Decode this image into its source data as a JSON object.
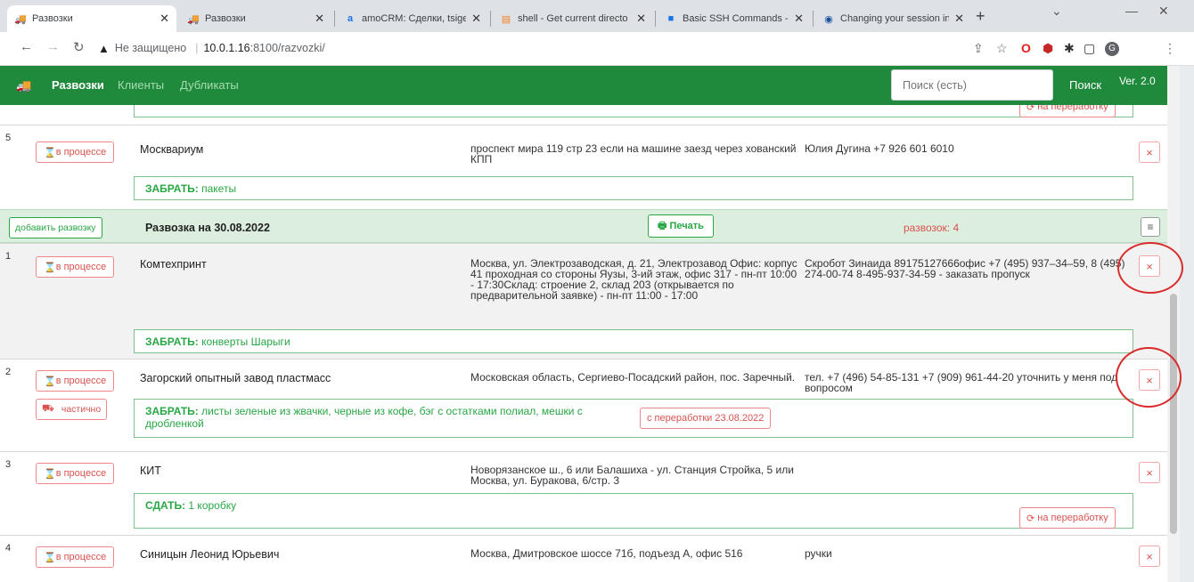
{
  "browser": {
    "tabs": [
      {
        "title": "Развозки",
        "active": true
      },
      {
        "title": "Развозки",
        "active": false
      },
      {
        "title": "amoCRM: Сделки, tsigel",
        "active": false
      },
      {
        "title": "shell - Get current directo",
        "active": false
      },
      {
        "title": "Basic SSH Commands - ",
        "active": false
      },
      {
        "title": "Changing your session in",
        "active": false
      }
    ],
    "address": {
      "insecure_label": "Не защищено",
      "host": "10.0.1.16",
      "port_path": ":8100/razvozki/"
    }
  },
  "navbar": {
    "brand": "Развозки",
    "links": [
      "Клиенты",
      "Дубликаты"
    ],
    "search_placeholder": "Поиск (есть)",
    "search_button": "Поиск",
    "version": "Ver. 2.0"
  },
  "top_partial": {
    "rework_label": "на переработку"
  },
  "row5": {
    "index": "5",
    "status": "в процессе",
    "name": "Москвариум",
    "address": "проспект мира 119 стр 23 если на машине заезд через хованский КПП",
    "contact": "Юлия Дугина +7 926 601 6010",
    "pick_label": "ЗАБРАТЬ:",
    "pick_text": "пакеты"
  },
  "group": {
    "add_button": "добавить развозку",
    "title": "Развозка на 30.08.2022",
    "print_button": "Печать",
    "count": "развозок: 4"
  },
  "rows": [
    {
      "index": "1",
      "status": "в процессе",
      "name": "Комтехпринт",
      "address": "Москва, ул. Электрозаводская, д. 21, Электрозавод Офис: корпус 41 проходная со стороны Яузы, 3-ий этаж, офис 317 - пн-пт 10:00 - 17:30Склад: строение 2, склад 203 (открывается по предварительной заявке) - пн-пт 11:00 - 17:00",
      "contact": "Скробот Зинаида 89175127666офис +7 (495) 937–34–59, 8 (495) 274-00-74 8-495-937-34-59 - заказать пропуск",
      "pick_label": "ЗАБРАТЬ:",
      "pick_text": "конверты Шарыги"
    },
    {
      "index": "2",
      "status": "в процессе",
      "partial": "частично",
      "name": "Загорский опытный завод пластмасс",
      "address": "Московская область, Сергиево-Посадский район, пос. Заречный.",
      "contact": "тел. +7 (496) 54-85-131 +7 (909) 961-44-20 уточнить у меня под вопросом",
      "pick_label": "ЗАБРАТЬ:",
      "pick_text": "листы зеленые из жвачки, черные из кофе, бэг с остатками полиал, мешки с дробленкой",
      "rework": "с переработки 23.08.2022"
    },
    {
      "index": "3",
      "status": "в процессе",
      "name": "КИТ",
      "address": "Новорязанское ш., 6 или Балашиха - ул. Станция Стройка, 5 или Москва, ул. Буракова, 6/стр. 3",
      "contact": "",
      "pick_label": "СДАТЬ:",
      "pick_text": "1 коробку",
      "rework": "на переработку"
    },
    {
      "index": "4",
      "status": "в процессе",
      "name": "Синицын Леонид Юрьевич",
      "address": "Москва, Дмитровское шоссе 71б, подъезд А, офис 516",
      "contact": "ручки"
    }
  ],
  "icons": {
    "hourglass": "⌛",
    "close": "×",
    "print": "🖶",
    "refresh": "⟳",
    "menu": "≡"
  },
  "colors": {
    "navbar_green": "#1f8a3c",
    "status_red": "#d9534f",
    "pick_green": "#28a745",
    "annotation_red": "#d92b2b"
  }
}
